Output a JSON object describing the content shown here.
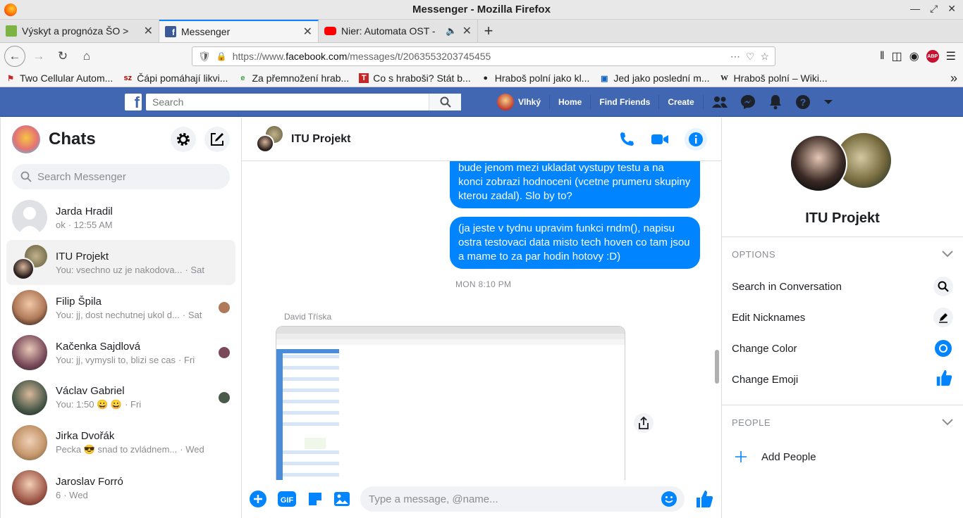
{
  "window": {
    "title": "Messenger - Mozilla Firefox"
  },
  "tabs": [
    {
      "label": "Výskyt a prognóza ŠO > ",
      "icon": "plant-favicon-icon",
      "color": "#7cb342"
    },
    {
      "label": "Messenger",
      "icon": "facebook-favicon-icon",
      "color": "#3b5998"
    },
    {
      "label": "Nier: Automata OST - ",
      "icon": "youtube-favicon-icon",
      "color": "#ff0000"
    }
  ],
  "url": {
    "prefix": "https://www.",
    "domain": "facebook.com",
    "path": "/messages/t/2063553203745455"
  },
  "bookmarks": [
    {
      "label": "Two Cellular Autom...",
      "icon": "bookmark-icon"
    },
    {
      "label": "Čápi pomáhají likvi...",
      "icon": "sz-icon"
    },
    {
      "label": "Za přemnožení hrab...",
      "icon": "leaf-icon"
    },
    {
      "label": "Co s hraboši? Stát b...",
      "icon": "t-icon"
    },
    {
      "label": "Hraboš polní jako kl...",
      "icon": "globe-icon"
    },
    {
      "label": "Jed jako poslední m...",
      "icon": "news-icon"
    },
    {
      "label": "Hraboš polní – Wiki...",
      "icon": "wikipedia-icon"
    }
  ],
  "fb": {
    "search_placeholder": "Search",
    "profile_name": "Vlhký",
    "nav": [
      "Home",
      "Find Friends",
      "Create"
    ]
  },
  "chats_panel": {
    "title": "Chats",
    "search_placeholder": "Search Messenger",
    "items": [
      {
        "name": "Jarda Hradil",
        "preview": "ok",
        "time": "· 12:55 AM",
        "avatar": "#d8dbe0"
      },
      {
        "name": "ITU Projekt",
        "preview": "You: vsechno uz je nakodova...",
        "time": "· Sat",
        "avatar": "#5d4a3c"
      },
      {
        "name": "Filip Špila",
        "preview": "You: jj, dost nechutnej ukol d...",
        "time": "· Sat",
        "avatar": "#b07a5a"
      },
      {
        "name": "Kačenka Sajdlová",
        "preview": "You: jj, vymysli to, blizi se cas",
        "time": "· Fri",
        "avatar": "#7a4a5a"
      },
      {
        "name": "Václav Gabriel",
        "preview": "You: 1:50 😀 😀",
        "time": "· Fri",
        "avatar": "#4a5a4a"
      },
      {
        "name": "Jirka Dvořák",
        "preview": "Pecka 😎 snad to zvládnem...",
        "time": "· Wed",
        "avatar": "#8a6a4a"
      },
      {
        "name": "Jaroslav Forró",
        "preview": "6",
        "time": "· Wed",
        "avatar": "#a05a4a"
      }
    ]
  },
  "conversation": {
    "title": "ITU Projekt",
    "messages": [
      {
        "text": "bude jenom mezi ukladat vystupy testu a na konci zobrazi hodnoceni (vcetne prumeru skupiny kterou zadal). Slo by to?"
      },
      {
        "text": "(ja jeste v tydnu upravim funkci rndm(), napisu ostra testovaci data misto tech hoven co tam jsou a mame to za par hodin hotovy :D)"
      }
    ],
    "timestamp": "MON 8:10 PM",
    "sender": "David Tříska",
    "composer_placeholder": "Type a message, @name..."
  },
  "info_panel": {
    "name": "ITU Projekt",
    "options_header": "OPTIONS",
    "options": [
      "Search in Conversation",
      "Edit Nicknames",
      "Change Color",
      "Change Emoji"
    ],
    "people_header": "PEOPLE",
    "add_people": "Add People"
  },
  "colors": {
    "accent": "#0084ff",
    "fb_blue": "#4267b2"
  }
}
